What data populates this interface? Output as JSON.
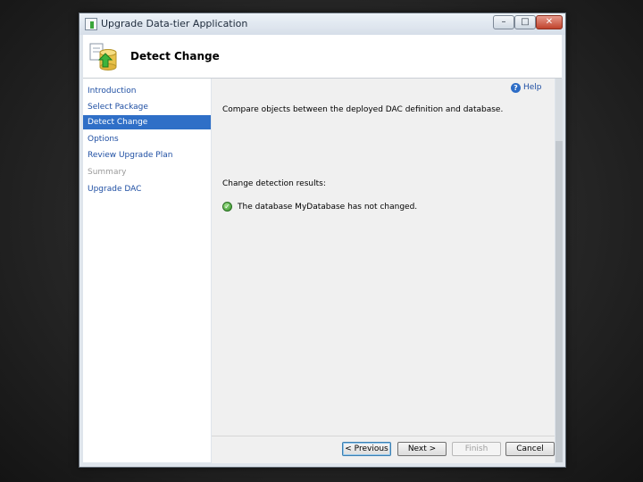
{
  "window": {
    "title": "Upgrade Data-tier Application",
    "controls": {
      "minimize": "–",
      "maximize": "□",
      "close": "✕"
    }
  },
  "header": {
    "title": "Detect Change",
    "icon": "upgrade-database-icon"
  },
  "sidebar": {
    "items": [
      {
        "label": "Introduction",
        "state": "link"
      },
      {
        "label": "Select Package",
        "state": "link"
      },
      {
        "label": "Detect Change",
        "state": "selected"
      },
      {
        "label": "Options",
        "state": "link"
      },
      {
        "label": "Review Upgrade Plan",
        "state": "link"
      },
      {
        "label": "Summary",
        "state": "disabled"
      },
      {
        "label": "Upgrade DAC",
        "state": "link"
      }
    ]
  },
  "content": {
    "help_label": "Help",
    "description": "Compare objects between the deployed DAC definition and database.",
    "results_label": "Change detection results:",
    "result_message": "The database MyDatabase has not changed.",
    "result_icon": "success-check-icon"
  },
  "buttons": {
    "previous": "< Previous",
    "next": "Next >",
    "finish": "Finish",
    "cancel": "Cancel"
  },
  "colors": {
    "selection": "#2f6fc7",
    "link": "#1f4fa3",
    "success": "#2e8f24"
  }
}
